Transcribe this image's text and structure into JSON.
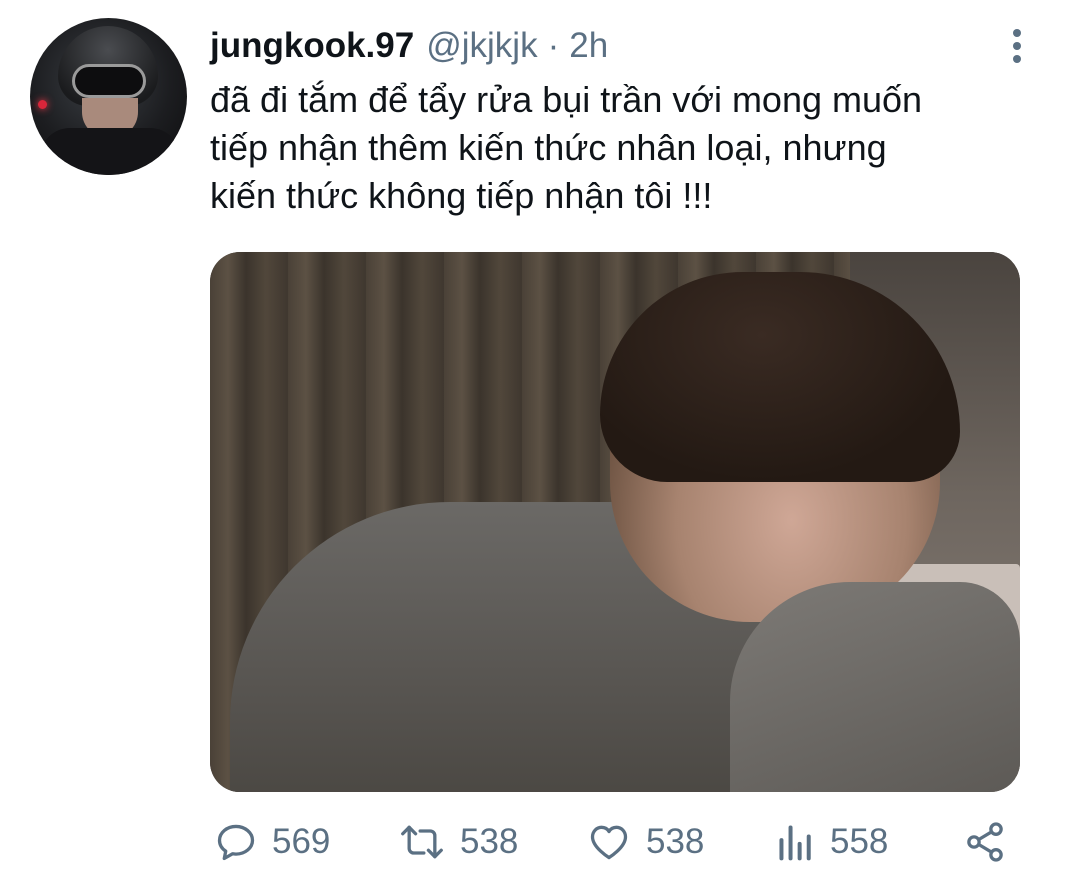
{
  "tweet": {
    "display_name": "jungkook.97",
    "handle": "@jkjkjk",
    "separator": "·",
    "time": "2h",
    "text_lines": [
      "đã đi tắm để tẩy rửa bụi trần với mong muốn",
      "tiếp nhận thêm kiến thức nhân loại, nhưng",
      "kiến thức không tiếp nhận tôi !!!"
    ]
  },
  "actions": {
    "replies": "569",
    "retweets": "538",
    "likes": "538",
    "views": "558"
  },
  "icons": {
    "more": "vertical-dots-icon",
    "reply": "speech-bubble-icon",
    "retweet": "retweet-arrows-icon",
    "like": "heart-icon",
    "views": "bar-chart-icon",
    "share": "share-nodes-icon"
  },
  "colors": {
    "text": "#0f1419",
    "secondary": "#5b7083"
  }
}
